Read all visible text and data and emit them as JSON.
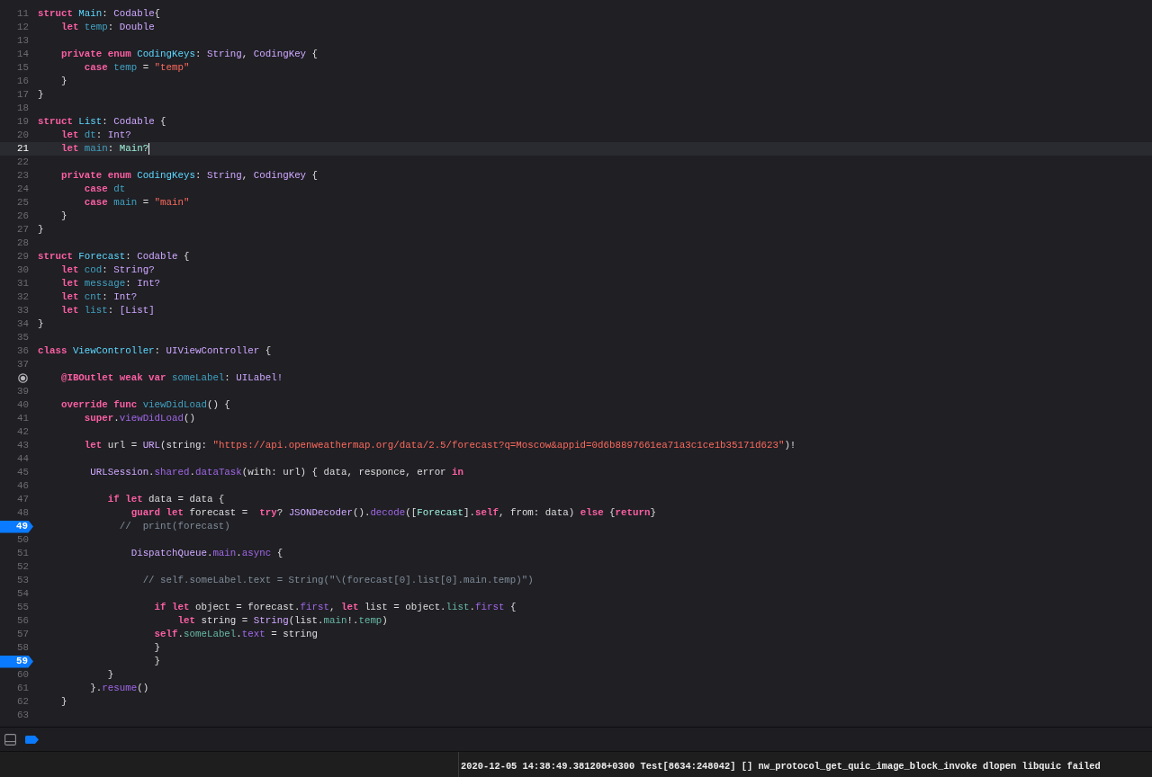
{
  "editor": {
    "lines": [
      {
        "number": "11",
        "tokens": [
          {
            "kind": "keyword",
            "t": "struct "
          },
          {
            "kind": "decl",
            "t": "Main"
          },
          {
            "kind": "plain",
            "t": ": "
          },
          {
            "kind": "type",
            "t": "Codable"
          },
          {
            "kind": "plain",
            "t": "{"
          }
        ]
      },
      {
        "number": "12",
        "tokens": [
          {
            "kind": "keyword",
            "t": "    let "
          },
          {
            "kind": "var",
            "t": "temp"
          },
          {
            "kind": "plain",
            "t": ": "
          },
          {
            "kind": "type",
            "t": "Double"
          }
        ]
      },
      {
        "number": "13"
      },
      {
        "number": "14",
        "tokens": [
          {
            "kind": "keyword",
            "t": "    private enum "
          },
          {
            "kind": "decl",
            "t": "CodingKeys"
          },
          {
            "kind": "plain",
            "t": ": "
          },
          {
            "kind": "type",
            "t": "String"
          },
          {
            "kind": "plain",
            "t": ", "
          },
          {
            "kind": "type",
            "t": "CodingKey"
          },
          {
            "kind": "plain",
            "t": " {"
          }
        ]
      },
      {
        "number": "15",
        "tokens": [
          {
            "kind": "keyword",
            "t": "        case "
          },
          {
            "kind": "var",
            "t": "temp"
          },
          {
            "kind": "plain",
            "t": " = "
          },
          {
            "kind": "string",
            "t": "\"temp\""
          }
        ]
      },
      {
        "number": "16",
        "tokens": [
          {
            "kind": "plain",
            "t": "    }"
          }
        ]
      },
      {
        "number": "17",
        "tokens": [
          {
            "kind": "plain",
            "t": "}"
          }
        ]
      },
      {
        "number": "18"
      },
      {
        "number": "19",
        "tokens": [
          {
            "kind": "keyword",
            "t": "struct "
          },
          {
            "kind": "decl",
            "t": "List"
          },
          {
            "kind": "plain",
            "t": ": "
          },
          {
            "kind": "type",
            "t": "Codable"
          },
          {
            "kind": "plain",
            "t": " {"
          }
        ]
      },
      {
        "number": "20",
        "tokens": [
          {
            "kind": "keyword",
            "t": "    let "
          },
          {
            "kind": "var",
            "t": "dt"
          },
          {
            "kind": "plain",
            "t": ": "
          },
          {
            "kind": "type",
            "t": "Int?"
          }
        ]
      },
      {
        "number": "21",
        "current": true,
        "tokens": [
          {
            "kind": "keyword",
            "t": "    let "
          },
          {
            "kind": "var",
            "t": "main"
          },
          {
            "kind": "plain",
            "t": ": "
          },
          {
            "kind": "project_type",
            "t": "Main?"
          }
        ]
      },
      {
        "number": "22"
      },
      {
        "number": "23",
        "tokens": [
          {
            "kind": "keyword",
            "t": "    private enum "
          },
          {
            "kind": "decl",
            "t": "CodingKeys"
          },
          {
            "kind": "plain",
            "t": ": "
          },
          {
            "kind": "type",
            "t": "String"
          },
          {
            "kind": "plain",
            "t": ", "
          },
          {
            "kind": "type",
            "t": "CodingKey"
          },
          {
            "kind": "plain",
            "t": " {"
          }
        ]
      },
      {
        "number": "24",
        "tokens": [
          {
            "kind": "keyword",
            "t": "        case "
          },
          {
            "kind": "var",
            "t": "dt"
          }
        ]
      },
      {
        "number": "25",
        "tokens": [
          {
            "kind": "keyword",
            "t": "        case "
          },
          {
            "kind": "var",
            "t": "main"
          },
          {
            "kind": "plain",
            "t": " = "
          },
          {
            "kind": "string",
            "t": "\"main\""
          }
        ]
      },
      {
        "number": "26",
        "tokens": [
          {
            "kind": "plain",
            "t": "    }"
          }
        ]
      },
      {
        "number": "27",
        "tokens": [
          {
            "kind": "plain",
            "t": "}"
          }
        ]
      },
      {
        "number": "28"
      },
      {
        "number": "29",
        "tokens": [
          {
            "kind": "keyword",
            "t": "struct "
          },
          {
            "kind": "decl",
            "t": "Forecast"
          },
          {
            "kind": "plain",
            "t": ": "
          },
          {
            "kind": "type",
            "t": "Codable"
          },
          {
            "kind": "plain",
            "t": " {"
          }
        ]
      },
      {
        "number": "30",
        "tokens": [
          {
            "kind": "keyword",
            "t": "    let "
          },
          {
            "kind": "var",
            "t": "cod"
          },
          {
            "kind": "plain",
            "t": ": "
          },
          {
            "kind": "type",
            "t": "String?"
          }
        ]
      },
      {
        "number": "31",
        "tokens": [
          {
            "kind": "keyword",
            "t": "    let "
          },
          {
            "kind": "var",
            "t": "message"
          },
          {
            "kind": "plain",
            "t": ": "
          },
          {
            "kind": "type",
            "t": "Int?"
          }
        ]
      },
      {
        "number": "32",
        "tokens": [
          {
            "kind": "keyword",
            "t": "    let "
          },
          {
            "kind": "var",
            "t": "cnt"
          },
          {
            "kind": "plain",
            "t": ": "
          },
          {
            "kind": "type",
            "t": "Int?"
          }
        ]
      },
      {
        "number": "33",
        "tokens": [
          {
            "kind": "keyword",
            "t": "    let "
          },
          {
            "kind": "var",
            "t": "list"
          },
          {
            "kind": "plain",
            "t": ": "
          },
          {
            "kind": "type",
            "t": "[List]"
          }
        ]
      },
      {
        "number": "34",
        "tokens": [
          {
            "kind": "plain",
            "t": "}"
          }
        ]
      },
      {
        "number": "35"
      },
      {
        "number": "36",
        "tokens": [
          {
            "kind": "keyword",
            "t": "class "
          },
          {
            "kind": "decl",
            "t": "ViewController"
          },
          {
            "kind": "plain",
            "t": ": "
          },
          {
            "kind": "type",
            "t": "UIViewController"
          },
          {
            "kind": "plain",
            "t": " {"
          }
        ]
      },
      {
        "number": "37"
      },
      {
        "outlet": true,
        "tokens": [
          {
            "kind": "keyword",
            "t": "    @IBOutlet weak var "
          },
          {
            "kind": "var",
            "t": "someLabel"
          },
          {
            "kind": "plain",
            "t": ": "
          },
          {
            "kind": "type",
            "t": "UILabel!"
          }
        ]
      },
      {
        "number": "39"
      },
      {
        "number": "40",
        "tokens": [
          {
            "kind": "keyword",
            "t": "    override func "
          },
          {
            "kind": "var",
            "t": "viewDidLoad"
          },
          {
            "kind": "plain",
            "t": "() {"
          }
        ]
      },
      {
        "number": "41",
        "tokens": [
          {
            "kind": "keyword",
            "t": "        super"
          },
          {
            "kind": "plain",
            "t": "."
          },
          {
            "kind": "method",
            "t": "viewDidLoad"
          },
          {
            "kind": "plain",
            "t": "()"
          }
        ]
      },
      {
        "number": "42"
      },
      {
        "number": "43",
        "tokens": [
          {
            "kind": "keyword",
            "t": "        let"
          },
          {
            "kind": "plain",
            "t": " url = "
          },
          {
            "kind": "type",
            "t": "URL"
          },
          {
            "kind": "plain",
            "t": "(string: "
          },
          {
            "kind": "string",
            "t": "\"https://api.openweathermap.org/data/2.5/forecast?q=Moscow&appid=0d6b8897661ea71a3c1ce1b35171d623\""
          },
          {
            "kind": "plain",
            "t": ")!"
          }
        ]
      },
      {
        "number": "44"
      },
      {
        "number": "45",
        "tokens": [
          {
            "kind": "type",
            "t": "         URLSession"
          },
          {
            "kind": "plain",
            "t": "."
          },
          {
            "kind": "method",
            "t": "shared"
          },
          {
            "kind": "plain",
            "t": "."
          },
          {
            "kind": "method",
            "t": "dataTask"
          },
          {
            "kind": "plain",
            "t": "(with: url) { data, responce, error "
          },
          {
            "kind": "keyword",
            "t": "in"
          }
        ]
      },
      {
        "number": "46"
      },
      {
        "number": "47",
        "tokens": [
          {
            "kind": "keyword",
            "t": "            if let"
          },
          {
            "kind": "plain",
            "t": " data = data {"
          }
        ]
      },
      {
        "number": "48",
        "tokens": [
          {
            "kind": "keyword",
            "t": "                guard let"
          },
          {
            "kind": "plain",
            "t": " forecast =  "
          },
          {
            "kind": "keyword",
            "t": "try"
          },
          {
            "kind": "plain",
            "t": "? "
          },
          {
            "kind": "type",
            "t": "JSONDecoder"
          },
          {
            "kind": "plain",
            "t": "()."
          },
          {
            "kind": "method",
            "t": "decode"
          },
          {
            "kind": "plain",
            "t": "(["
          },
          {
            "kind": "project_type",
            "t": "Forecast"
          },
          {
            "kind": "plain",
            "t": "]."
          },
          {
            "kind": "keyword",
            "t": "self"
          },
          {
            "kind": "plain",
            "t": ", from: data) "
          },
          {
            "kind": "keyword",
            "t": "else"
          },
          {
            "kind": "plain",
            "t": " {"
          },
          {
            "kind": "keyword",
            "t": "return"
          },
          {
            "kind": "plain",
            "t": "}"
          }
        ]
      },
      {
        "number": "49",
        "breakpoint": true,
        "tokens": [
          {
            "kind": "comment",
            "t": "              //  print(forecast)"
          }
        ]
      },
      {
        "number": "50"
      },
      {
        "number": "51",
        "tokens": [
          {
            "kind": "type",
            "t": "                DispatchQueue"
          },
          {
            "kind": "plain",
            "t": "."
          },
          {
            "kind": "method",
            "t": "main"
          },
          {
            "kind": "plain",
            "t": "."
          },
          {
            "kind": "method",
            "t": "async"
          },
          {
            "kind": "plain",
            "t": " {"
          }
        ]
      },
      {
        "number": "52"
      },
      {
        "number": "53",
        "tokens": [
          {
            "kind": "comment",
            "t": "                  // self.someLabel.text = String(\"\\(forecast[0].list[0].main.temp)\")"
          }
        ]
      },
      {
        "number": "54"
      },
      {
        "number": "55",
        "tokens": [
          {
            "kind": "keyword",
            "t": "                    if let"
          },
          {
            "kind": "plain",
            "t": " object = forecast."
          },
          {
            "kind": "method",
            "t": "first"
          },
          {
            "kind": "plain",
            "t": ", "
          },
          {
            "kind": "keyword",
            "t": "let"
          },
          {
            "kind": "plain",
            "t": " list = object."
          },
          {
            "kind": "project_member",
            "t": "list"
          },
          {
            "kind": "plain",
            "t": "."
          },
          {
            "kind": "method",
            "t": "first"
          },
          {
            "kind": "plain",
            "t": " {"
          }
        ]
      },
      {
        "number": "56",
        "tokens": [
          {
            "kind": "keyword",
            "t": "                        let"
          },
          {
            "kind": "plain",
            "t": " string = "
          },
          {
            "kind": "type",
            "t": "String"
          },
          {
            "kind": "plain",
            "t": "(list."
          },
          {
            "kind": "project_member",
            "t": "main"
          },
          {
            "kind": "plain",
            "t": "!."
          },
          {
            "kind": "project_member",
            "t": "temp"
          },
          {
            "kind": "plain",
            "t": ")"
          }
        ]
      },
      {
        "number": "57",
        "tokens": [
          {
            "kind": "keyword",
            "t": "                    self"
          },
          {
            "kind": "plain",
            "t": "."
          },
          {
            "kind": "project_member",
            "t": "someLabel"
          },
          {
            "kind": "plain",
            "t": "."
          },
          {
            "kind": "method",
            "t": "text"
          },
          {
            "kind": "plain",
            "t": " = string"
          }
        ]
      },
      {
        "number": "58",
        "tokens": [
          {
            "kind": "plain",
            "t": "                    }"
          }
        ]
      },
      {
        "number": "59",
        "breakpoint": true,
        "tokens": [
          {
            "kind": "plain",
            "t": "                    }"
          }
        ]
      },
      {
        "number": "60",
        "tokens": [
          {
            "kind": "plain",
            "t": "            }"
          }
        ]
      },
      {
        "number": "61",
        "tokens": [
          {
            "kind": "plain",
            "t": "         }."
          },
          {
            "kind": "method",
            "t": "resume"
          },
          {
            "kind": "plain",
            "t": "()"
          }
        ]
      },
      {
        "number": "62",
        "tokens": [
          {
            "kind": "plain",
            "t": "    }"
          }
        ]
      },
      {
        "number": "63"
      }
    ]
  },
  "debug_bar": {
    "breakpoints_active": true
  },
  "console": {
    "output": "2020-12-05 14:38:49.381208+0300 Test[8634:248042] [] nw_protocol_get_quic_image_block_invoke dlopen libquic failed"
  }
}
